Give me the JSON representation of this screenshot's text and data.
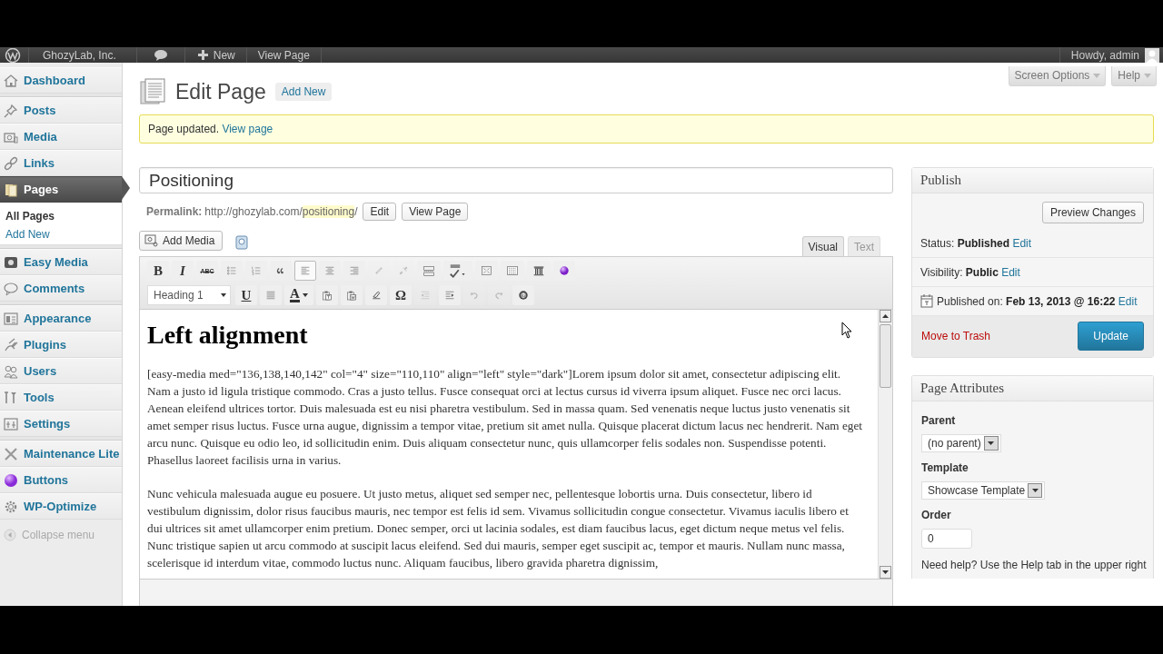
{
  "admin_bar": {
    "site": "GhozyLab, Inc.",
    "new": "New",
    "view": "View Page",
    "greeting": "Howdy, admin"
  },
  "menu_groups": [
    [
      {
        "label": "Dashboard",
        "selected": false
      }
    ],
    [
      {
        "label": "Posts",
        "selected": false
      },
      {
        "label": "Media",
        "selected": false
      },
      {
        "label": "Links",
        "selected": false
      },
      {
        "label": "Pages",
        "selected": true,
        "children": [
          {
            "label": "All Pages",
            "selected": true
          },
          {
            "label": "Add New",
            "selected": false
          }
        ]
      }
    ],
    [
      {
        "label": "Easy Media",
        "selected": false
      },
      {
        "label": "Comments",
        "selected": false
      }
    ],
    [
      {
        "label": "Appearance",
        "selected": false
      },
      {
        "label": "Plugins",
        "selected": false
      },
      {
        "label": "Users",
        "selected": false
      },
      {
        "label": "Tools",
        "selected": false
      },
      {
        "label": "Settings",
        "selected": false
      }
    ],
    [
      {
        "label": "Maintenance Lite",
        "selected": false
      },
      {
        "label": "Buttons",
        "selected": false
      },
      {
        "label": "WP-Optimize",
        "selected": false
      }
    ]
  ],
  "collapse_menu": "Collapse menu",
  "header": {
    "title": "Edit Page",
    "add_new": "Add New"
  },
  "screen_tabs": [
    "Screen Options",
    "Help"
  ],
  "notice": {
    "text": "Page updated.",
    "link": "View page"
  },
  "post": {
    "title": "Positioning",
    "permalink_label": "Permalink:",
    "permalink_base": "http://ghozylab.com/",
    "permalink_slug": "positioning",
    "permalink_end": "/",
    "buttons": [
      "Edit",
      "View Page"
    ]
  },
  "add_media": "Add Media",
  "editor_tabs": [
    {
      "label": "Visual",
      "selected": true
    },
    {
      "label": "Text",
      "selected": false
    }
  ],
  "toolbar_rows": [
    [
      {
        "kind": "text",
        "text": "B",
        "active": false,
        "disabled": false
      },
      {
        "kind": "text",
        "text": "I",
        "active": false,
        "disabled": false
      },
      {
        "kind": "text",
        "text": "ABC",
        "active": false,
        "disabled": false
      },
      {
        "kind": "icon",
        "active": false,
        "disabled": false
      },
      {
        "kind": "icon",
        "active": false,
        "disabled": false
      },
      {
        "kind": "icon",
        "active": false,
        "disabled": false
      },
      {
        "kind": "icon",
        "active": true,
        "disabled": false
      },
      {
        "kind": "icon",
        "active": false,
        "disabled": false
      },
      {
        "kind": "icon",
        "active": false,
        "disabled": false
      },
      {
        "kind": "icon",
        "active": false,
        "disabled": true
      },
      {
        "kind": "icon",
        "active": false,
        "disabled": true
      },
      {
        "kind": "icon",
        "active": false,
        "disabled": false
      },
      {
        "kind": "icon",
        "active": false,
        "disabled": false
      },
      {
        "kind": "icon",
        "active": false,
        "disabled": false
      },
      {
        "kind": "icon",
        "active": false,
        "disabled": false
      },
      {
        "kind": "icon",
        "active": false,
        "disabled": false
      },
      {
        "kind": "icon",
        "active": false,
        "disabled": false
      }
    ],
    [
      {
        "kind": "select",
        "text": "Heading 1"
      },
      {
        "kind": "text",
        "text": "U",
        "active": false,
        "disabled": false
      },
      {
        "kind": "icon",
        "active": false,
        "disabled": false
      },
      {
        "kind": "text",
        "text": "A",
        "active": false,
        "disabled": false
      },
      {
        "kind": "icon",
        "active": false,
        "disabled": false
      },
      {
        "kind": "icon",
        "active": false,
        "disabled": false
      },
      {
        "kind": "icon",
        "active": false,
        "disabled": false
      },
      {
        "kind": "text",
        "text": "Ω",
        "active": false,
        "disabled": false
      },
      {
        "kind": "icon",
        "active": false,
        "disabled": true
      },
      {
        "kind": "icon",
        "active": false,
        "disabled": false
      },
      {
        "kind": "icon",
        "active": false,
        "disabled": true
      },
      {
        "kind": "icon",
        "active": false,
        "disabled": true
      },
      {
        "kind": "icon",
        "active": false,
        "disabled": false
      }
    ]
  ],
  "content": {
    "heading": "Left alignment",
    "paragraphs": [
      "[easy-media med=\"136,138,140,142\" col=\"4\" size=\"110,110\" align=\"left\" style=\"dark\"]Lorem ipsum dolor sit amet, consectetur adipiscing elit. Nam a justo id ligula tristique commodo. Cras a justo tellus. Fusce consequat orci at lectus cursus id viverra ipsum aliquet. Fusce nec orci lacus. Aenean eleifend ultrices tortor. Duis malesuada est eu nisi pharetra vestibulum. Sed in massa quam. Sed venenatis neque luctus justo venenatis sit amet semper risus luctus. Fusce urna augue, dignissim a tempor vitae, pretium sit amet nulla. Quisque placerat dictum lacus nec hendrerit. Nam eget arcu nunc. Quisque eu odio leo, id sollicitudin enim. Duis aliquam consectetur nunc, quis ullamcorper felis sodales non. Suspendisse potenti. Phasellus laoreet facilisis urna in varius.",
      "Nunc vehicula malesuada augue eu posuere. Ut justo metus, aliquet sed semper nec, pellentesque lobortis urna. Duis consectetur, libero id vestibulum dignissim, dolor risus faucibus mauris, nec tempor est felis id sem. Vivamus sollicitudin congue consectetur. Vivamus iaculis libero et dui ultrices sit amet ullamcorper enim pretium. Donec semper, orci ut lacinia sodales, est diam faucibus lacus, eget dictum neque metus vel felis. Nunc tristique sapien ut arcu commodo at suscipit lacus eleifend. Sed dui mauris, semper eget suscipit ac, tempor et mauris. Nullam nunc massa, scelerisque id interdum vitae, commodo luctus nunc. Aliquam faucibus, libero gravida pharetra dignissim,"
    ]
  },
  "publish": {
    "title": "Publish",
    "preview": "Preview Changes",
    "rows": [
      {
        "kind": "plain",
        "text": "Status: **Published**",
        "link": "Edit"
      },
      {
        "kind": "plain",
        "text": "Visibility: **Public**",
        "link": "Edit"
      },
      {
        "kind": "date",
        "text": "Published on: **Feb 13, 2013 @ 16:22**",
        "link": "Edit"
      }
    ],
    "trash": "Move to Trash",
    "update": "Update"
  },
  "page_attributes": {
    "title": "Page Attributes",
    "parent_label": "Parent",
    "parent": "(no parent)",
    "template_label": "Template",
    "template": "Showcase Template",
    "order_label": "Order",
    "order": "0",
    "help": "Need help? Use the Help tab in the upper right"
  }
}
